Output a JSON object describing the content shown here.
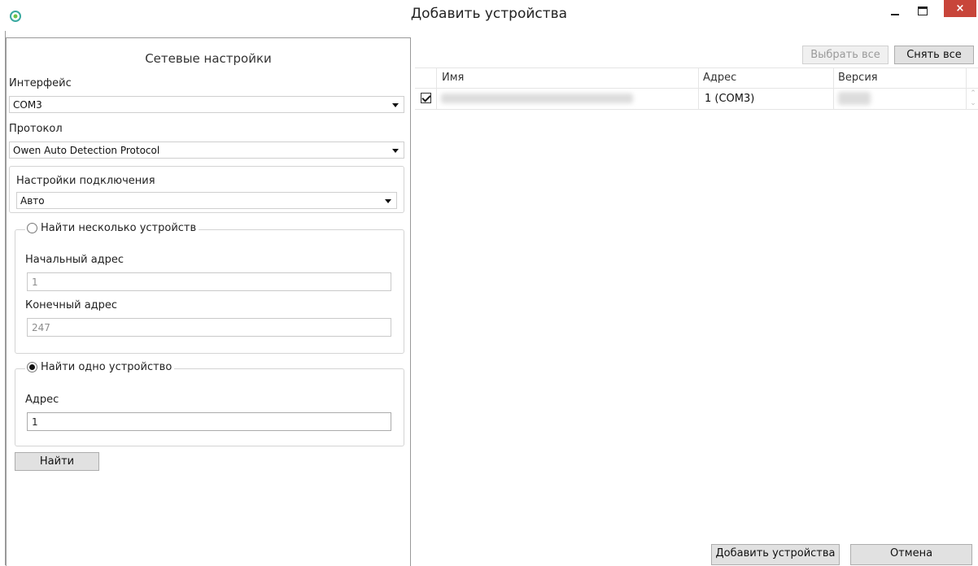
{
  "window": {
    "title": "Добавить устройства",
    "icon": "app-logo-icon",
    "controls": {
      "minimize": "minimize-icon",
      "maximize": "maximize-icon",
      "close": "×"
    }
  },
  "network_settings": {
    "title": "Сетевые настройки",
    "interface": {
      "label": "Интерфейс",
      "value": "COM3"
    },
    "protocol": {
      "label": "Протокол",
      "value": "Owen Auto Detection Protocol"
    },
    "connection": {
      "label": "Настройки подключения",
      "value": "Авто"
    },
    "multi_search": {
      "label": "Найти несколько устройств",
      "selected": false,
      "start_label": "Начальный адрес",
      "start_value": "1",
      "end_label": "Конечный адрес",
      "end_value": "247"
    },
    "single_search": {
      "label": "Найти одно устройство",
      "selected": true,
      "address_label": "Адрес",
      "address_value": "1"
    },
    "find_button": "Найти"
  },
  "devices": {
    "select_all": "Выбрать все",
    "deselect_all": "Снять все",
    "columns": [
      "Имя",
      "Адрес",
      "Версия"
    ],
    "rows": [
      {
        "checked": true,
        "address": "1 (COM3)"
      }
    ]
  },
  "footer": {
    "add_button": "Добавить устройства",
    "cancel_button": "Отмена"
  },
  "colors": {
    "close_button": "#c8453a",
    "accent": "#3aa9a0"
  }
}
